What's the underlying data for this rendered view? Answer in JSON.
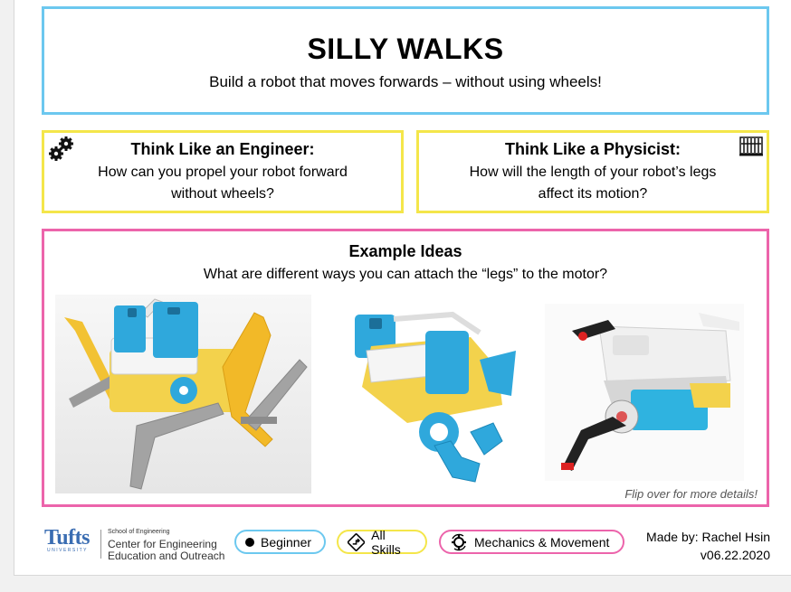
{
  "header": {
    "title": "SILLY WALKS",
    "subtitle": "Build a robot that moves forwards – without using wheels!"
  },
  "engineer": {
    "heading": "Think Like an Engineer:",
    "question": "How can you propel your robot forward without wheels?",
    "icon": "gears-icon"
  },
  "physicist": {
    "heading": "Think Like a Physicist:",
    "question": "How will the length of your robot’s legs affect its motion?",
    "icon": "abacus-icon"
  },
  "ideas": {
    "heading": "Example Ideas",
    "question": "What are different ways you can attach the “legs” to the motor?",
    "flip_note": "Flip over for more details!"
  },
  "footer": {
    "logo": {
      "wordmark": "Tufts",
      "university": "UNIVERSITY",
      "school": "School of Engineering",
      "center_line1": "Center for Engineering",
      "center_line2": "Education and Outreach"
    },
    "level": "Beginner",
    "skills": "All Skills",
    "topic": "Mechanics & Movement",
    "made_by": "Made by: Rachel Hsin",
    "version": "v06.22.2020"
  },
  "colors": {
    "blue": "#6cc8ef",
    "yellow": "#f4e64a",
    "pink": "#ec64ab"
  }
}
